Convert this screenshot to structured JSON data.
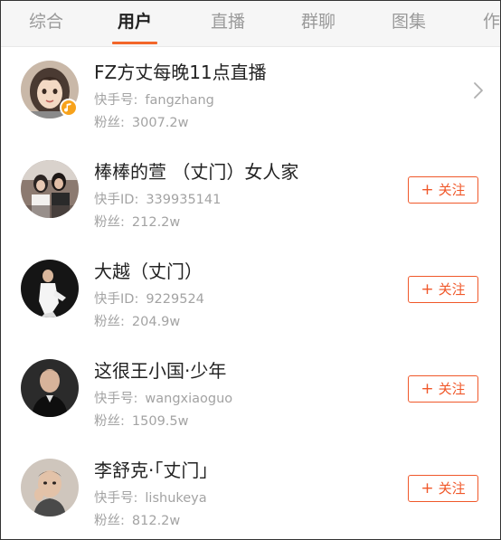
{
  "tabs": [
    {
      "label": "综合"
    },
    {
      "label": "用户"
    },
    {
      "label": "直播"
    },
    {
      "label": "群聊"
    },
    {
      "label": "图集"
    },
    {
      "label": "作"
    }
  ],
  "active_tab": "用户",
  "accent_color": "#f0582a",
  "users": [
    {
      "name": "FZ方丈每晚11点直播",
      "id_label": "快手号:",
      "id_value": "fangzhang",
      "fans_label": "粉丝:",
      "fans_value": "3007.2w",
      "action": "chevron-right-icon"
    },
    {
      "name": "棒棒的萱 （丈门）女人家",
      "id_label": "快手ID:",
      "id_value": "339935141",
      "fans_label": "粉丝:",
      "fans_value": "212.2w",
      "follow_label": "关注"
    },
    {
      "name": "大越（丈门）",
      "id_label": "快手ID:",
      "id_value": "9229524",
      "fans_label": "粉丝:",
      "fans_value": "204.9w",
      "follow_label": "关注"
    },
    {
      "name": "这很王小国·少年",
      "id_label": "快手号:",
      "id_value": "wangxiaoguo",
      "fans_label": "粉丝:",
      "fans_value": "1509.5w",
      "follow_label": "关注"
    },
    {
      "name": "李舒克·「丈门」",
      "id_label": "快手号:",
      "id_value": "lishukeya",
      "fans_label": "粉丝:",
      "fans_value": "812.2w",
      "follow_label": "关注"
    }
  ],
  "follow_plus": "+"
}
